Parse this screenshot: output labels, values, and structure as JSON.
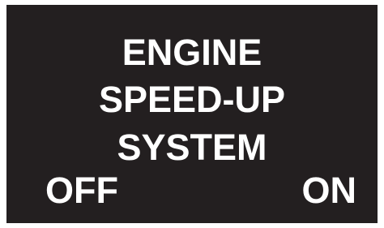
{
  "label_panel": {
    "title_lines": [
      "ENGINE",
      "SPEED-UP",
      "SYSTEM"
    ],
    "off_label": "OFF",
    "on_label": "ON",
    "background_color": "#231f20",
    "text_color": "#ffffff"
  }
}
